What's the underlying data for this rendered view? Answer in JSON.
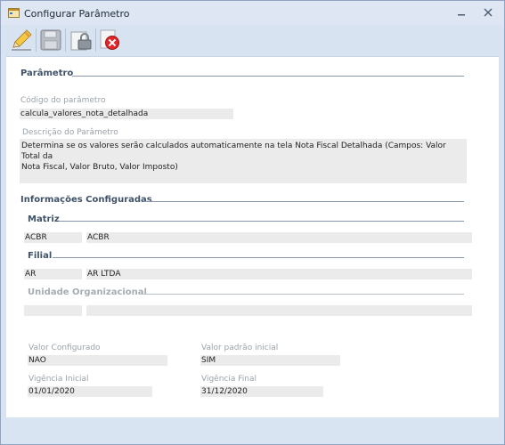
{
  "window": {
    "title": "Configurar Parâmetro",
    "minimize_icon": "minimize-icon",
    "close_icon": "close-icon"
  },
  "toolbar": {
    "buttons": [
      {
        "name": "edit",
        "icon": "pencil-icon"
      },
      {
        "name": "save",
        "icon": "floppy-disk-icon"
      },
      {
        "name": "lock",
        "icon": "padlock-icon"
      },
      {
        "name": "cancel",
        "icon": "red-x-icon"
      }
    ]
  },
  "parametro": {
    "section_title": "Parâmetro",
    "codigo_label": "Código do parâmetro",
    "codigo_value": "calcula_valores_nota_detalhada",
    "descricao_label": "Descrição do Parâmetro",
    "descricao_line1": "Determina se os valores serão calculados automaticamente na tela Nota Fiscal Detalhada (Campos: Valor Total da",
    "descricao_line2": "Nota Fiscal, Valor Bruto, Valor Imposto)"
  },
  "informacoes": {
    "section_title": "Informações Configuradas",
    "matriz": {
      "title": "Matriz",
      "code": "ACBR",
      "name": "ACBR"
    },
    "filial": {
      "title": "Filial",
      "code": "AR",
      "name": "AR LTDA"
    },
    "unidade": {
      "title": "Unidade Organizacional",
      "code": "",
      "name": ""
    }
  },
  "valores": {
    "valor_configurado_label": "Valor Configurado",
    "valor_configurado": "NAO",
    "valor_padrao_label": "Valor padrão inicial",
    "valor_padrao": "SIM",
    "vigencia_inicial_label": "Vigência Inicial",
    "vigencia_inicial": "01/01/2020",
    "vigencia_final_label": "Vigência Final",
    "vigencia_final": "31/12/2020"
  },
  "colors": {
    "section_text": "#3f5269",
    "label_text": "#9aa2ab",
    "field_bg": "#ebebeb",
    "chrome_bg": "#d9e4f2"
  }
}
